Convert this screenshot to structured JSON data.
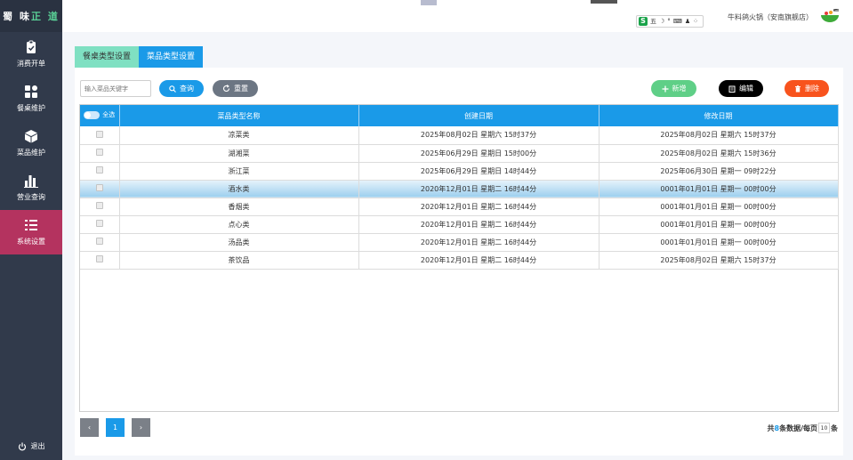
{
  "brand": {
    "part1": "蜀 味",
    "part2": " 正 道"
  },
  "sidebar": {
    "items": [
      {
        "label": "消费开单",
        "icon": "clipboard-icon"
      },
      {
        "label": "餐桌维护",
        "icon": "grid-icon"
      },
      {
        "label": "菜品维护",
        "icon": "cube-icon"
      },
      {
        "label": "营业查询",
        "icon": "bar-chart-icon"
      },
      {
        "label": "系统设置",
        "icon": "list-settings-icon",
        "active": true
      }
    ],
    "logout": "退出"
  },
  "header": {
    "ime_glyph": "五",
    "store_name": "牛料鸽火锅（安南旗舰店）"
  },
  "tabs": [
    {
      "label": "餐桌类型设置"
    },
    {
      "label": "菜品类型设置",
      "active": true
    }
  ],
  "toolbar": {
    "search_placeholder": "输入菜品关键字",
    "query": "查询",
    "reset": "重置",
    "add": "新增",
    "edit": "编辑",
    "delete": "删除"
  },
  "table": {
    "select_all": "全选",
    "columns": [
      "菜品类型名称",
      "创建日期",
      "修改日期"
    ],
    "rows": [
      {
        "name": "凉菜类",
        "created": "2025年08月02日 星期六 15时37分",
        "modified": "2025年08月02日 星期六 15时37分"
      },
      {
        "name": "湖湘菜",
        "created": "2025年06月29日 星期日 15时00分",
        "modified": "2025年08月02日 星期六 15时36分"
      },
      {
        "name": "浙江菜",
        "created": "2025年06月29日 星期日 14时44分",
        "modified": "2025年06月30日 星期一 09时22分"
      },
      {
        "name": "酒水类",
        "created": "2020年12月01日 星期二 16时44分",
        "modified": "0001年01月01日 星期一 00时00分",
        "selected": true
      },
      {
        "name": "香烟类",
        "created": "2020年12月01日 星期二 16时44分",
        "modified": "0001年01月01日 星期一 00时00分"
      },
      {
        "name": "点心类",
        "created": "2020年12月01日 星期二 16时44分",
        "modified": "0001年01月01日 星期一 00时00分"
      },
      {
        "name": "汤品类",
        "created": "2020年12月01日 星期二 16时44分",
        "modified": "0001年01月01日 星期一 00时00分"
      },
      {
        "name": "茶饮品",
        "created": "2020年12月01日 星期二 16时44分",
        "modified": "2025年08月02日 星期六 15时37分"
      }
    ]
  },
  "pager": {
    "prev": "‹",
    "page": "1",
    "next": "›"
  },
  "summary": {
    "prefix": "共",
    "count": "8",
    "mid": "条数据/每页",
    "page_size": "10",
    "suffix": "条"
  },
  "colors": {
    "primary": "#1a9ae8",
    "sidebar": "#313a4b",
    "active_nav": "#b4335f",
    "add": "#5fcf87",
    "delete": "#f8531d"
  }
}
